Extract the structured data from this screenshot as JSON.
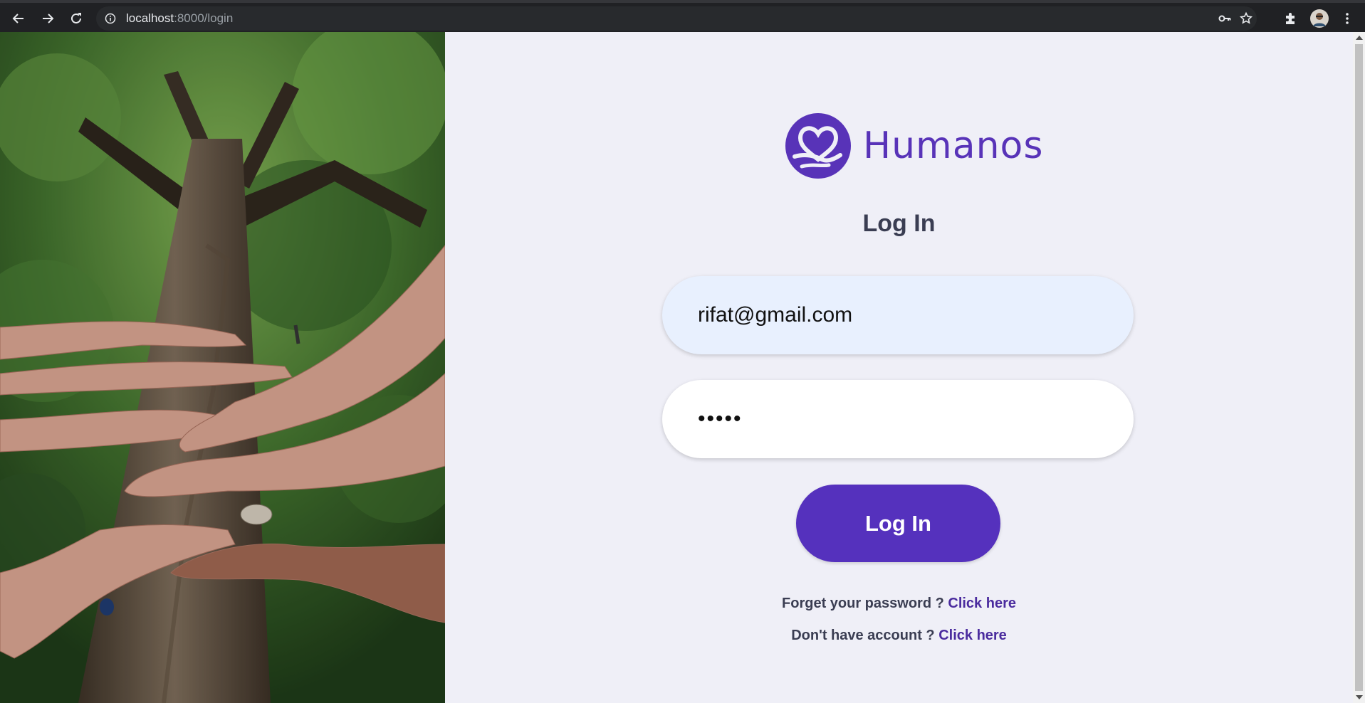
{
  "browser": {
    "url_host": "localhost",
    "url_path": ":8000/login",
    "icons": {
      "back": "back-arrow-icon",
      "forward": "forward-arrow-icon",
      "reload": "reload-icon",
      "site_info": "info-icon",
      "password_key": "key-icon",
      "bookmark": "star-icon",
      "extensions": "puzzle-icon",
      "profile": "avatar",
      "menu": "kebab-menu-icon"
    }
  },
  "brand": {
    "name": "Humanos",
    "logo": "heart-hands-logo",
    "color": "#5833b8"
  },
  "login": {
    "heading": "Log In",
    "email_value": "rifat@gmail.com",
    "password_value": "12345",
    "submit_label": "Log In",
    "accent_color": "#5531bd"
  },
  "links": {
    "forgot_text": "Forget your password ? ",
    "forgot_link": "Click here",
    "signup_text": "Don't have account ? ",
    "signup_link": "Click here"
  },
  "hero": {
    "image": "hands-on-tree-trunk-photo"
  }
}
